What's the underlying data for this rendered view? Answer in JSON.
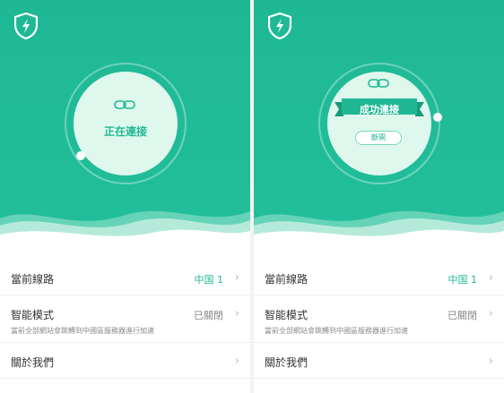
{
  "brand": {
    "accent": "#20b893",
    "core": "#dff8ee",
    "logo_icon": "shield-bolt-icon"
  },
  "screens": [
    {
      "state": "connecting",
      "status_text": "正在連接",
      "list": {
        "route": {
          "label": "當前線路",
          "value": "中国 1"
        },
        "smart": {
          "label": "智能模式",
          "value": "已關閉",
          "desc": "當前全部網站會跳轉到中國區服務器進行加速"
        },
        "about": {
          "label": "關於我們"
        }
      }
    },
    {
      "state": "connected",
      "status_text": "成功連接",
      "button_label": "斷開",
      "list": {
        "route": {
          "label": "當前線路",
          "value": "中国 1"
        },
        "smart": {
          "label": "智能模式",
          "value": "已關閉",
          "desc": "當前全部網站會跳轉到中國區服務器進行加速"
        },
        "about": {
          "label": "關於我們"
        }
      }
    }
  ]
}
